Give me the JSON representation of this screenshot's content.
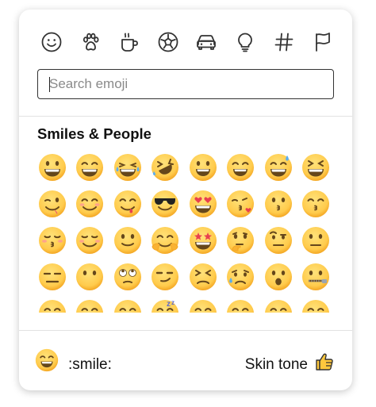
{
  "categories": [
    {
      "name": "smiles-people",
      "icon": "smiley-icon"
    },
    {
      "name": "animals-nature",
      "icon": "paw-icon"
    },
    {
      "name": "food-drink",
      "icon": "cup-icon"
    },
    {
      "name": "activities",
      "icon": "soccer-ball-icon"
    },
    {
      "name": "travel-places",
      "icon": "car-icon"
    },
    {
      "name": "objects",
      "icon": "lightbulb-icon"
    },
    {
      "name": "symbols",
      "icon": "hash-icon"
    },
    {
      "name": "flags",
      "icon": "flag-icon"
    }
  ],
  "search": {
    "placeholder": "Search emoji",
    "value": ""
  },
  "section": {
    "title": "Smiles & People"
  },
  "emojis": [
    {
      "shortcode": "grinning",
      "face": "grin",
      "accent": ""
    },
    {
      "shortcode": "grin",
      "face": "grin-wide",
      "accent": ""
    },
    {
      "shortcode": "joy",
      "face": "laugh-tears",
      "accent": ""
    },
    {
      "shortcode": "rofl",
      "face": "laugh-tears-tilt",
      "accent": ""
    },
    {
      "shortcode": "smiley",
      "face": "open-smile",
      "accent": ""
    },
    {
      "shortcode": "smile",
      "face": "smile-open",
      "accent": ""
    },
    {
      "shortcode": "sweat_smile",
      "face": "grin-sweat",
      "accent": ""
    },
    {
      "shortcode": "laughing",
      "face": "squint-laugh",
      "accent": ""
    },
    {
      "shortcode": "wink",
      "face": "wink",
      "accent": ""
    },
    {
      "shortcode": "blush",
      "face": "blush",
      "accent": ""
    },
    {
      "shortcode": "yum",
      "face": "yum",
      "accent": ""
    },
    {
      "shortcode": "sunglasses",
      "face": "sunglasses",
      "accent": ""
    },
    {
      "shortcode": "heart_eyes",
      "face": "heart-eyes",
      "accent": ""
    },
    {
      "shortcode": "kissing_heart",
      "face": "kiss-heart",
      "accent": ""
    },
    {
      "shortcode": "kissing",
      "face": "kiss",
      "accent": ""
    },
    {
      "shortcode": "kissing_smiling_eyes",
      "face": "kiss-smile",
      "accent": ""
    },
    {
      "shortcode": "kissing_closed_eyes",
      "face": "kiss-closed",
      "accent": ""
    },
    {
      "shortcode": "relaxed",
      "face": "relaxed",
      "accent": ""
    },
    {
      "shortcode": "slightly_smiling_face",
      "face": "slight-smile",
      "accent": ""
    },
    {
      "shortcode": "hugs",
      "face": "hug",
      "accent": ""
    },
    {
      "shortcode": "star_struck",
      "face": "star-eyes",
      "accent": ""
    },
    {
      "shortcode": "thinking",
      "face": "think",
      "accent": ""
    },
    {
      "shortcode": "raised_eyebrow",
      "face": "eyebrow",
      "accent": ""
    },
    {
      "shortcode": "neutral_face",
      "face": "neutral",
      "accent": ""
    },
    {
      "shortcode": "expressionless",
      "face": "expressionless",
      "accent": ""
    },
    {
      "shortcode": "no_mouth",
      "face": "no-mouth",
      "accent": ""
    },
    {
      "shortcode": "roll_eyes",
      "face": "roll-eyes",
      "accent": ""
    },
    {
      "shortcode": "smirk",
      "face": "smirk",
      "accent": ""
    },
    {
      "shortcode": "persevere",
      "face": "persevere",
      "accent": ""
    },
    {
      "shortcode": "disappointed_relieved",
      "face": "sad-sweat",
      "accent": ""
    },
    {
      "shortcode": "open_mouth",
      "face": "open-mouth",
      "accent": ""
    },
    {
      "shortcode": "zipper_mouth",
      "face": "zipper",
      "accent": ""
    },
    {
      "shortcode": "hushed",
      "face": "partial",
      "accent": ""
    },
    {
      "shortcode": "sleepy",
      "face": "partial",
      "accent": ""
    },
    {
      "shortcode": "tired_face",
      "face": "partial",
      "accent": ""
    },
    {
      "shortcode": "sleeping",
      "face": "partial-zzz",
      "accent": ""
    },
    {
      "shortcode": "relieved",
      "face": "partial",
      "accent": ""
    },
    {
      "shortcode": "stuck_out_tongue",
      "face": "partial",
      "accent": ""
    },
    {
      "shortcode": "stuck_out_tongue_winking_eye",
      "face": "partial",
      "accent": ""
    },
    {
      "shortcode": "stuck_out_tongue_closed_eyes",
      "face": "partial",
      "accent": ""
    }
  ],
  "footer": {
    "preview_code": ":smile:",
    "skin_tone_label": "Skin tone"
  },
  "colors": {
    "face_yellow": "#FFCB4C",
    "face_outline": "#F4A825",
    "feature_brown": "#65471B",
    "tear_blue": "#5DADEC",
    "heart_red": "#E8404F",
    "icon_stroke": "#333333",
    "thumb_yellow": "#FFC83D"
  }
}
